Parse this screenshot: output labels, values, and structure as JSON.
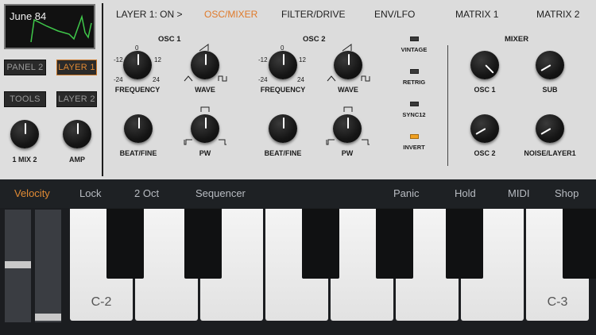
{
  "preset": {
    "name": "June 84"
  },
  "panel_buttons": {
    "panel2": "PANEL 2",
    "layer1": "LAYER 1",
    "tools": "TOOLS",
    "layer2": "LAYER 2"
  },
  "left_knobs": {
    "mix": "1 MIX 2",
    "amp": "AMP"
  },
  "tabs": {
    "layer": "LAYER 1: ON >",
    "osc_mixer": "OSC/MIXER",
    "filter_drive": "FILTER/DRIVE",
    "env_lfo": "ENV/LFO",
    "matrix1": "MATRIX 1",
    "matrix2": "MATRIX 2"
  },
  "osc1": {
    "title": "OSC 1",
    "freq_label": "FREQUENCY",
    "wave_label": "WAVE",
    "beat_label": "BEAT/FINE",
    "pw_label": "PW",
    "ticks": {
      "top": "0",
      "upper_left": "-12",
      "upper_right": "12",
      "lower_left": "-24",
      "lower_right": "24"
    }
  },
  "osc2": {
    "title": "OSC 2",
    "freq_label": "FREQUENCY",
    "wave_label": "WAVE",
    "beat_label": "BEAT/FINE",
    "pw_label": "PW",
    "ticks": {
      "top": "0",
      "upper_left": "-12",
      "upper_right": "12",
      "lower_left": "-24",
      "lower_right": "24"
    }
  },
  "switches": {
    "vintage": "VINTAGE",
    "retrig": "RETRIG",
    "sync12": "SYNC12",
    "invert": "INVERT"
  },
  "mixer": {
    "title": "MIXER",
    "osc1": "OSC 1",
    "sub": "SUB",
    "osc2": "OSC 2",
    "noise": "NOISE/LAYER1"
  },
  "controls": {
    "velocity": "Velocity",
    "lock": "Lock",
    "octave": "2 Oct",
    "sequencer": "Sequencer",
    "panic": "Panic",
    "hold": "Hold",
    "midi": "MIDI",
    "shop": "Shop"
  },
  "keyboard": {
    "low_label": "C-2",
    "high_label": "C-3"
  },
  "colors": {
    "accent": "#e07a2a",
    "panel": "#dcdcdc",
    "bar": "#1e2124"
  }
}
